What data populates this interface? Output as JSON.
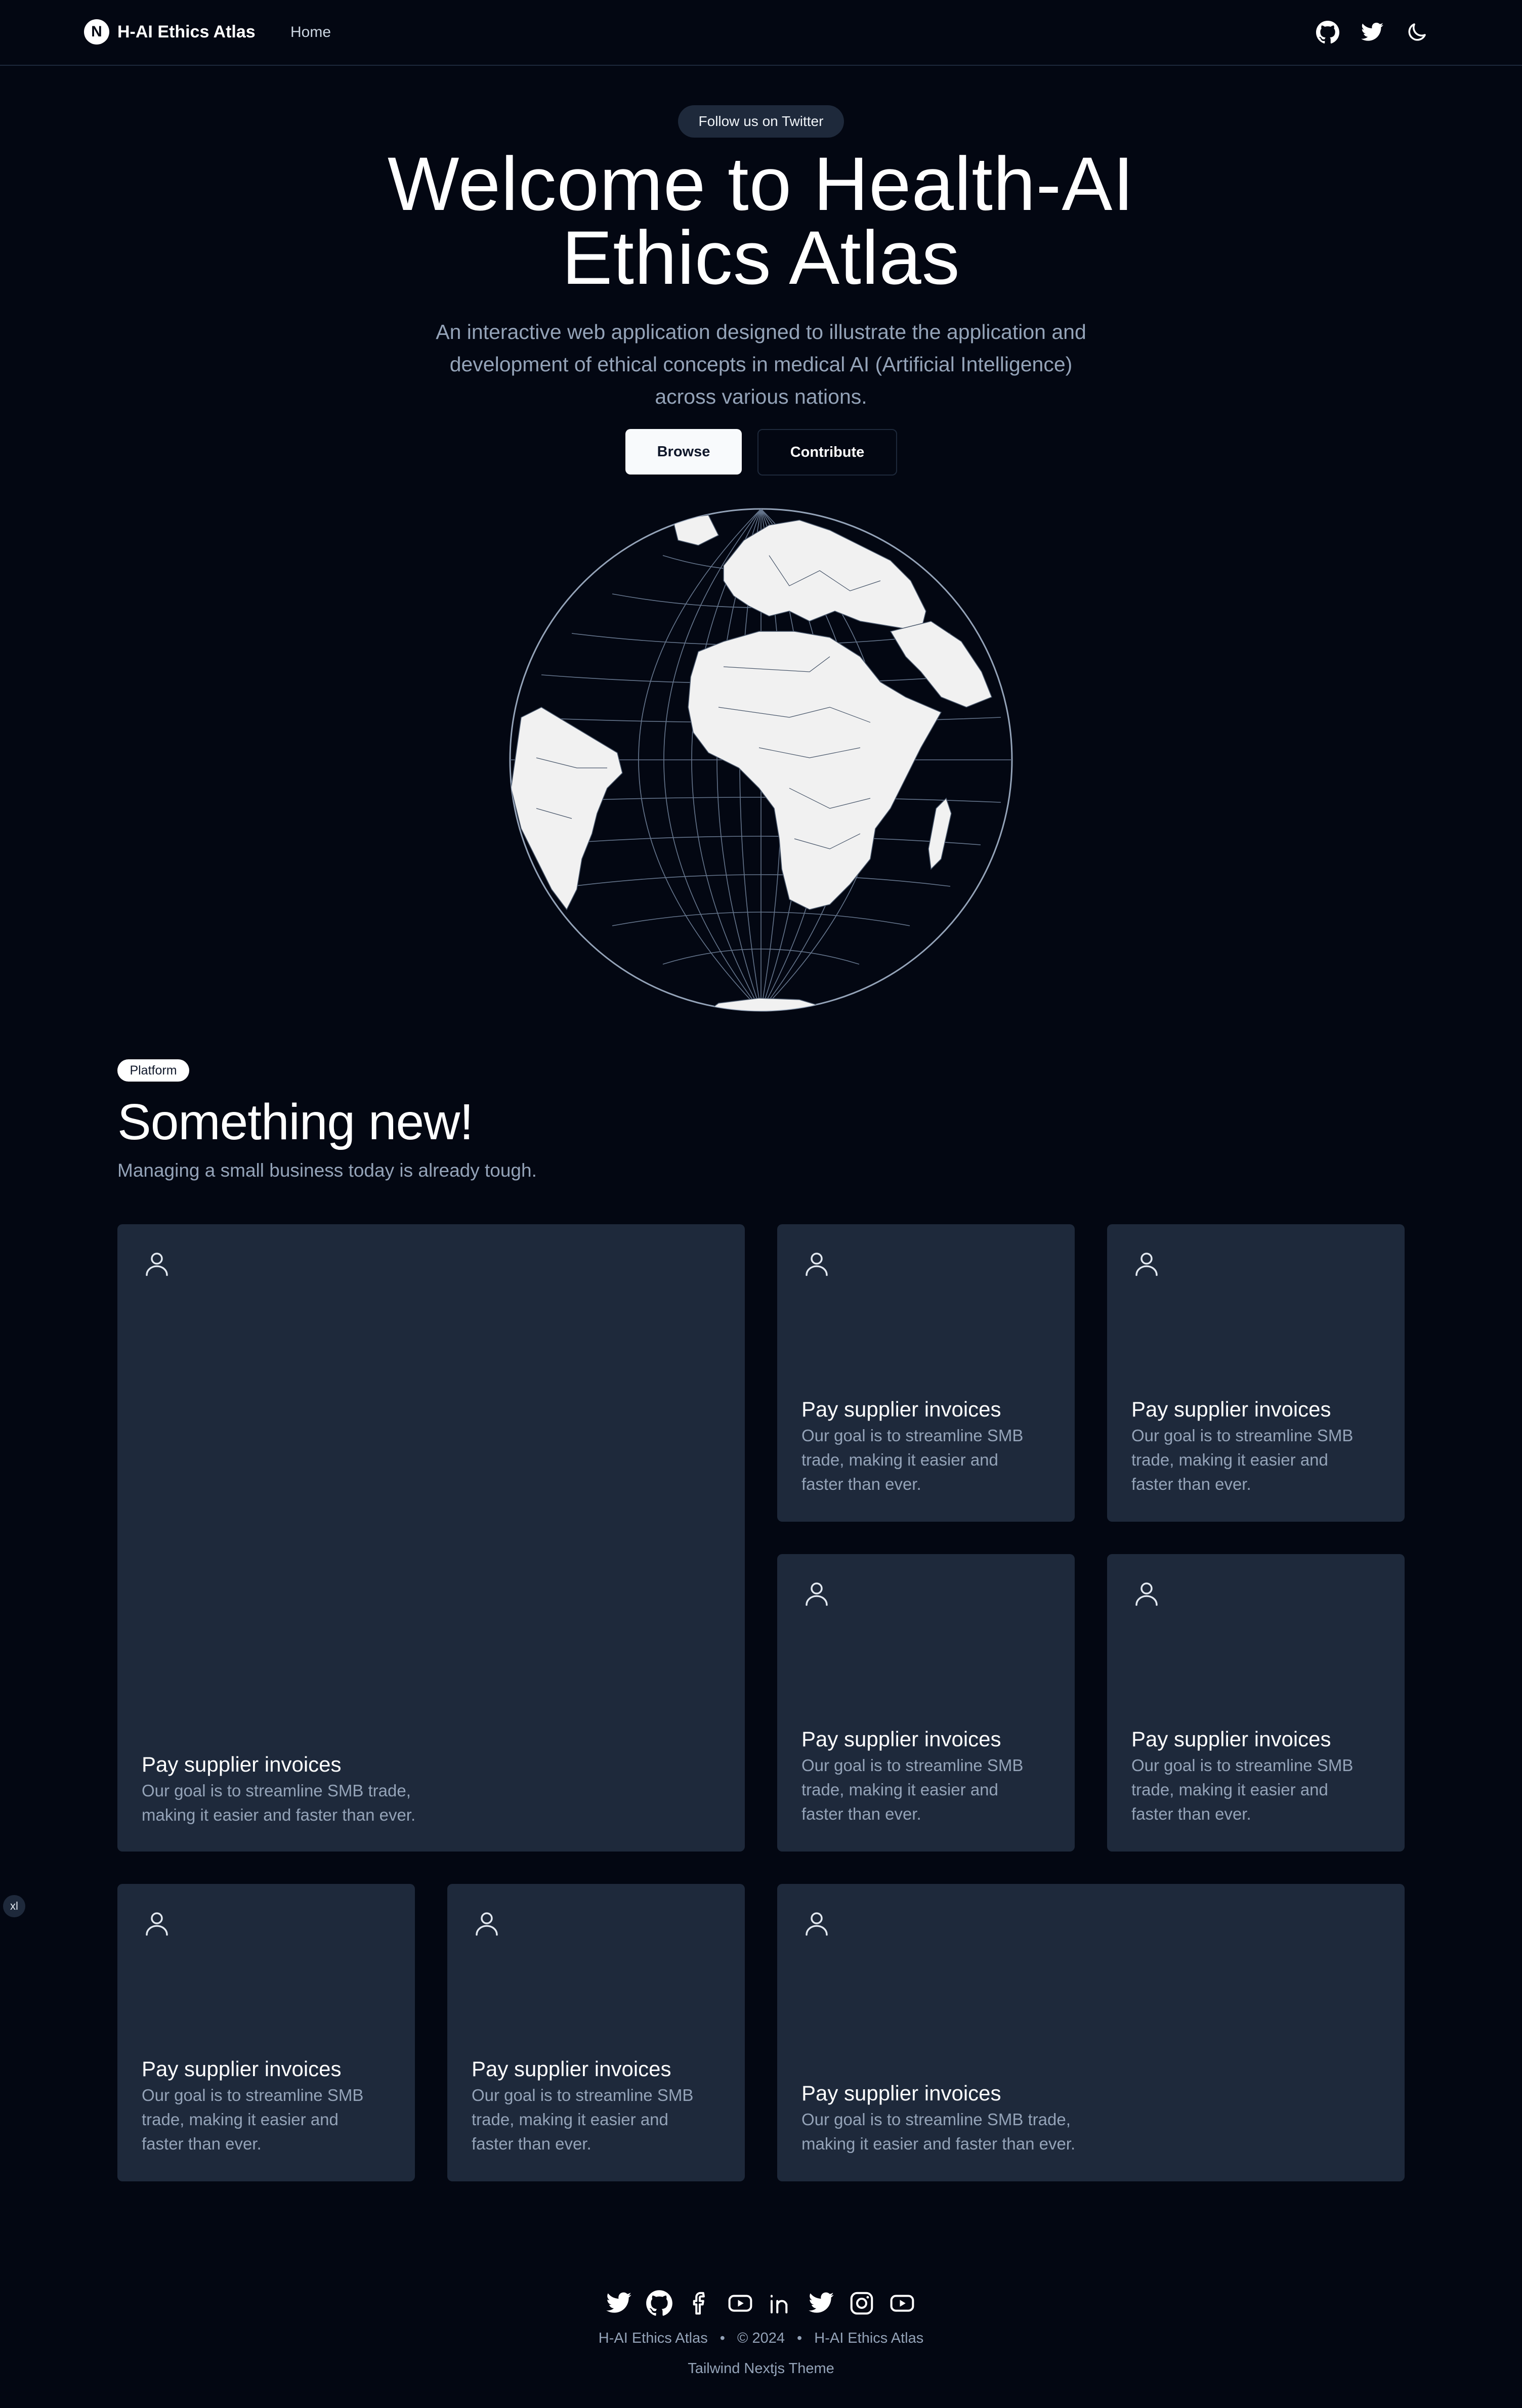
{
  "nav": {
    "brand_letter": "N",
    "brand": "H-AI Ethics Atlas",
    "home": "Home",
    "icons": [
      "github-icon",
      "twitter-icon",
      "moon-icon"
    ]
  },
  "hero": {
    "pill": "Follow us on Twitter",
    "title_line1": "Welcome to Health-AI",
    "title_line2": "Ethics Atlas",
    "subtitle": "An interactive web application designed to illustrate the application and development of ethical concepts in medical AI (Artificial Intelligence) across various nations.",
    "browse_label": "Browse",
    "contribute_label": "Contribute"
  },
  "section": {
    "badge": "Platform",
    "title": "Something new!",
    "subtitle": "Managing a small business today is already tough."
  },
  "cards": [
    {
      "icon": "user-icon",
      "title": "Pay supplier invoices",
      "desc": "Our goal is to streamline SMB trade, making it easier and faster than ever."
    },
    {
      "icon": "user-icon",
      "title": "Pay supplier invoices",
      "desc": "Our goal is to streamline SMB trade, making it easier and faster than ever."
    },
    {
      "icon": "user-icon",
      "title": "Pay supplier invoices",
      "desc": "Our goal is to streamline SMB trade, making it easier and faster than ever."
    },
    {
      "icon": "user-icon",
      "title": "Pay supplier invoices",
      "desc": "Our goal is to streamline SMB trade, making it easier and faster than ever."
    },
    {
      "icon": "user-icon",
      "title": "Pay supplier invoices",
      "desc": "Our goal is to streamline SMB trade, making it easier and faster than ever."
    },
    {
      "icon": "user-icon",
      "title": "Pay supplier invoices",
      "desc": "Our goal is to streamline SMB trade, making it easier and faster than ever."
    },
    {
      "icon": "user-icon",
      "title": "Pay supplier invoices",
      "desc": "Our goal is to streamline SMB trade, making it easier and faster than ever."
    },
    {
      "icon": "user-icon",
      "title": "Pay supplier invoices",
      "desc": "Our goal is to streamline SMB trade, making it easier and faster than ever."
    }
  ],
  "breakpoint_badge": "xl",
  "footer": {
    "social_icons": [
      "twitter-icon",
      "github-icon",
      "facebook-icon",
      "youtube-icon",
      "linkedin-icon",
      "twitter-icon",
      "instagram-icon",
      "youtube-icon"
    ],
    "left": "H-AI Ethics Atlas",
    "sep": "•",
    "copyright": "© 2024",
    "right": "H-AI Ethics Atlas",
    "theme": "Tailwind Nextjs Theme"
  },
  "colors": {
    "background": "#030712",
    "card": "#1e293b",
    "muted_text": "#94a3b8",
    "primary_button": "#f8fafc"
  }
}
